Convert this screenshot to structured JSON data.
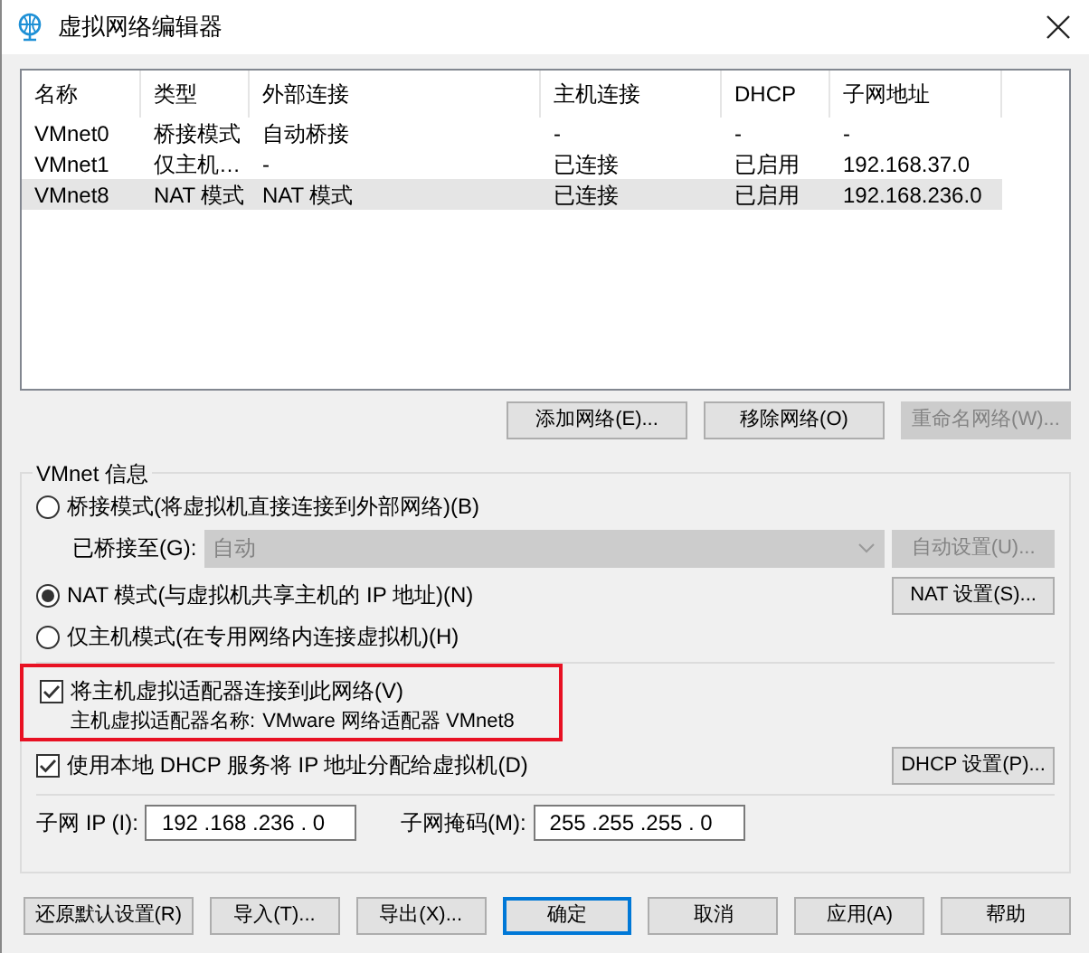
{
  "window": {
    "title": "虚拟网络编辑器"
  },
  "table": {
    "columns": [
      "名称",
      "类型",
      "外部连接",
      "主机连接",
      "DHCP",
      "子网地址"
    ],
    "rows": [
      {
        "cells": [
          "VMnet0",
          "桥接模式",
          "自动桥接",
          "-",
          "-",
          "-"
        ],
        "selected": false
      },
      {
        "cells": [
          "VMnet1",
          "仅主机…",
          "-",
          "已连接",
          "已启用",
          "192.168.37.0"
        ],
        "selected": false
      },
      {
        "cells": [
          "VMnet8",
          "NAT 模式",
          "NAT 模式",
          "已连接",
          "已启用",
          "192.168.236.0"
        ],
        "selected": true
      }
    ]
  },
  "network_buttons": [
    {
      "label": "添加网络(E)...",
      "disabled": false
    },
    {
      "label": "移除网络(O)",
      "disabled": false
    },
    {
      "label": "重命名网络(W)...",
      "disabled": true
    }
  ],
  "info": {
    "title": "VMnet 信息",
    "modes": [
      {
        "label": "桥接模式(将虚拟机直接连接到外部网络)(B)",
        "selected": false
      },
      {
        "label": "NAT 模式(与虚拟机共享主机的 IP 地址)(N)",
        "selected": true
      },
      {
        "label": "仅主机模式(在专用网络内连接虚拟机)(H)",
        "selected": false
      }
    ],
    "bridged_to": {
      "label": "已桥接至(G):",
      "value": "自动",
      "disabled": true,
      "button": {
        "label": "自动设置(U)...",
        "disabled": true
      }
    },
    "nat_button": {
      "label": "NAT 设置(S)...",
      "disabled": false
    },
    "connect_adapter": {
      "label": "将主机虚拟适配器连接到此网络(V)",
      "checked": true,
      "highlighted": true,
      "adapter_label": "主机虚拟适配器名称:",
      "adapter_name": "VMware 网络适配器 VMnet8"
    },
    "dhcp": {
      "label": "使用本地 DHCP 服务将 IP 地址分配给虚拟机(D)",
      "checked": true,
      "button": {
        "label": "DHCP 设置(P)...",
        "disabled": false
      }
    },
    "subnet_ip": {
      "label": "子网 IP (I):",
      "value": "192 .168 .236 . 0"
    },
    "subnet_mask": {
      "label": "子网掩码(M):",
      "value": "255 .255 .255 . 0"
    }
  },
  "dialog_buttons": [
    {
      "label": "还原默认设置(R)",
      "default": false
    },
    {
      "label": "导入(T)...",
      "default": false
    },
    {
      "label": "导出(X)...",
      "default": false
    },
    {
      "label": "确定",
      "default": true
    },
    {
      "label": "取消",
      "default": false
    },
    {
      "label": "应用(A)",
      "default": false
    },
    {
      "label": "帮助",
      "default": false
    }
  ]
}
